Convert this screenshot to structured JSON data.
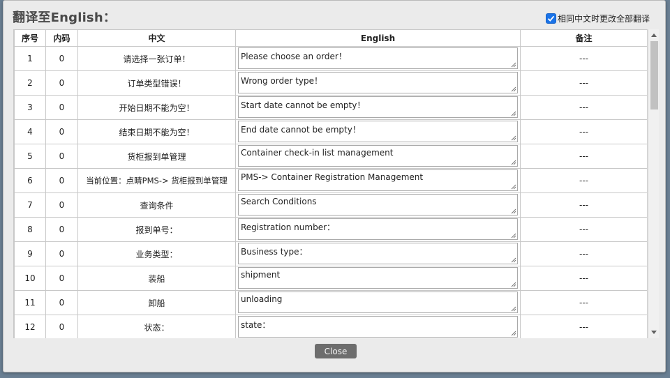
{
  "dialog": {
    "title": "翻译至English：",
    "sync_checkbox": {
      "checked": true,
      "label": "相同中文时更改全部翻译"
    },
    "close_label": "Close"
  },
  "table": {
    "headers": {
      "seq": "序号",
      "builtin": "内码",
      "zh": "中文",
      "en": "English",
      "note": "备注"
    },
    "rows": [
      {
        "seq": "1",
        "builtin": "0",
        "zh": "请选择一张订单！",
        "en": "Please choose an order！",
        "note": "---"
      },
      {
        "seq": "2",
        "builtin": "0",
        "zh": "订单类型错误！",
        "en": "Wrong order type！",
        "note": "---"
      },
      {
        "seq": "3",
        "builtin": "0",
        "zh": "开始日期不能为空！",
        "en": "Start date cannot be empty！",
        "note": "---"
      },
      {
        "seq": "4",
        "builtin": "0",
        "zh": "结束日期不能为空！",
        "en": "End date cannot be empty！",
        "note": "---"
      },
      {
        "seq": "5",
        "builtin": "0",
        "zh": "货柜报到单管理",
        "en": "Container check-in list management",
        "note": "---"
      },
      {
        "seq": "6",
        "builtin": "0",
        "zh": "当前位置：点睛PMS-> 货柜报到单管理",
        "en": "PMS->  Container Registration Management",
        "note": "---"
      },
      {
        "seq": "7",
        "builtin": "0",
        "zh": "查询条件",
        "en": "Search Conditions",
        "note": "---"
      },
      {
        "seq": "8",
        "builtin": "0",
        "zh": "报到单号：",
        "en": "Registration number：",
        "note": "---"
      },
      {
        "seq": "9",
        "builtin": "0",
        "zh": "业务类型：",
        "en": "Business type：",
        "note": "---"
      },
      {
        "seq": "10",
        "builtin": "0",
        "zh": "装船",
        "en": "shipment",
        "note": "---"
      },
      {
        "seq": "11",
        "builtin": "0",
        "zh": "卸船",
        "en": "unloading",
        "note": "---"
      },
      {
        "seq": "12",
        "builtin": "0",
        "zh": "状态：",
        "en": "state：",
        "note": "---"
      }
    ]
  },
  "icons": {
    "checkbox": "checkmark-icon",
    "resize": "resize-grip-icon",
    "scroll_up": "chevron-up-icon",
    "scroll_down": "chevron-down-icon"
  }
}
